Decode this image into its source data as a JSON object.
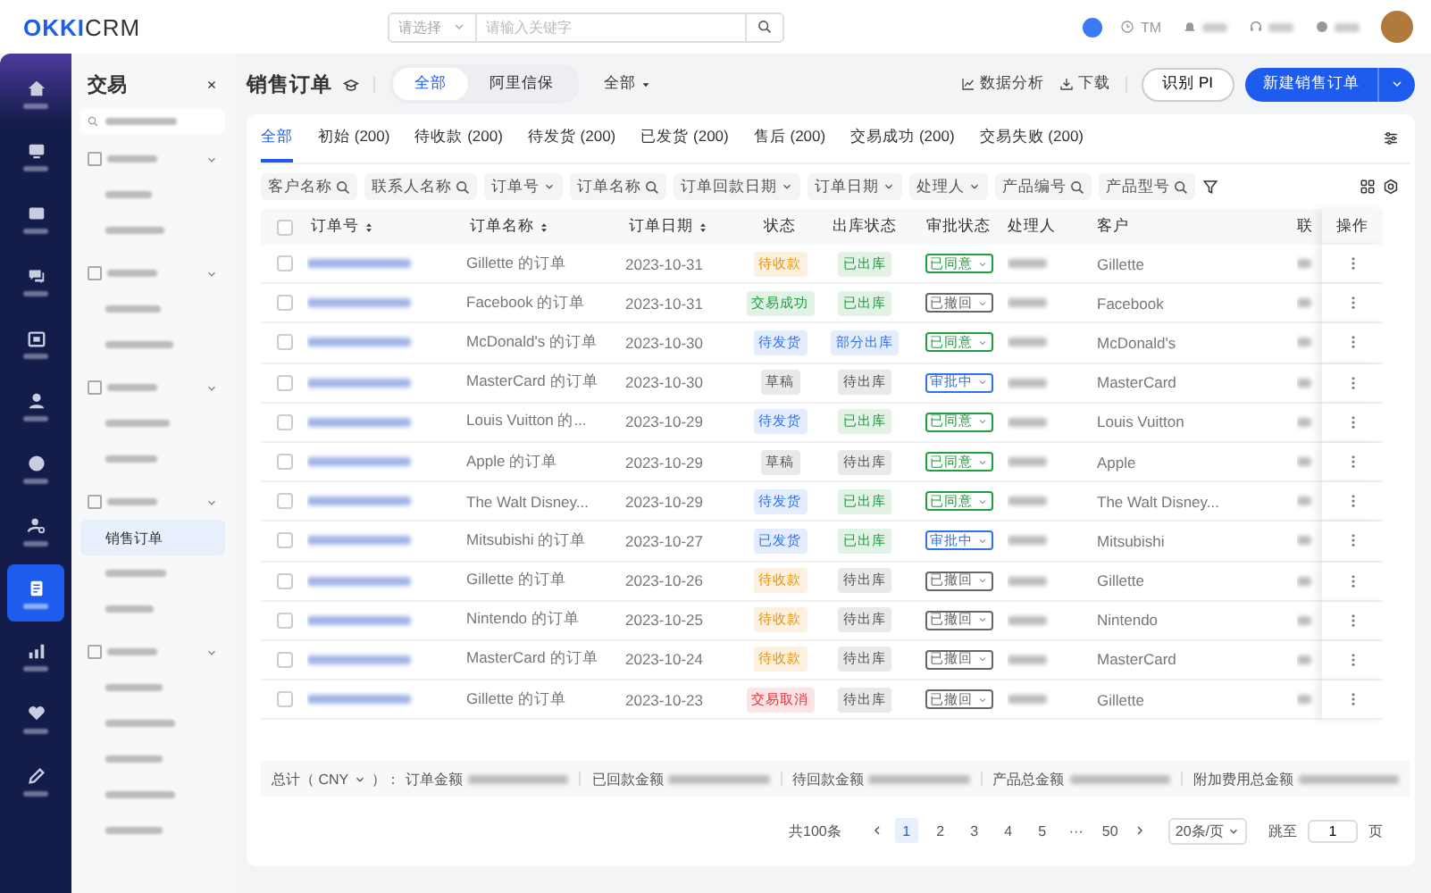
{
  "topbar": {
    "logo_bold": "OKKI",
    "logo_rest": "CRM",
    "search_select": "请选择",
    "search_placeholder": "请输入关键字",
    "user_short": "TM"
  },
  "rail": {
    "items": [
      {
        "selected": false
      },
      {
        "selected": false
      },
      {
        "selected": false
      },
      {
        "selected": false
      },
      {
        "selected": false
      },
      {
        "selected": false
      },
      {
        "selected": false
      },
      {
        "selected": false
      },
      {
        "selected": true
      },
      {
        "selected": false
      },
      {
        "selected": false
      },
      {
        "selected": false
      }
    ]
  },
  "menu": {
    "title": "交易",
    "groups": [
      {
        "expanded": true,
        "items": [
          {
            "selected": false
          },
          {
            "selected": false
          }
        ]
      },
      {
        "expanded": true,
        "items": [
          {
            "selected": false
          },
          {
            "selected": false
          }
        ]
      },
      {
        "expanded": true,
        "items": [
          {
            "selected": false
          },
          {
            "selected": false
          }
        ]
      },
      {
        "expanded": true,
        "items": [
          {
            "label": "销售订单",
            "selected": true
          },
          {
            "selected": false
          },
          {
            "selected": false
          }
        ]
      },
      {
        "expanded": true,
        "items": [
          {
            "selected": false
          },
          {
            "selected": false
          },
          {
            "selected": false
          },
          {
            "selected": false
          },
          {
            "selected": false
          }
        ]
      }
    ]
  },
  "header": {
    "title": "销售订单",
    "segments": [
      {
        "label": "全部",
        "selected": true
      },
      {
        "label": "阿里信保",
        "selected": false
      }
    ],
    "scope": "全部",
    "actions": [
      {
        "label": "数据分析",
        "kind": "chart"
      },
      {
        "label": "下载",
        "kind": "download"
      }
    ],
    "secondary_button": "识别 PI",
    "primary_button": "新建销售订单"
  },
  "tabs": [
    {
      "label": "全部",
      "selected": true
    },
    {
      "label": "初始 (200)",
      "selected": false
    },
    {
      "label": "待收款 (200)",
      "selected": false
    },
    {
      "label": "待发货 (200)",
      "selected": false
    },
    {
      "label": "已发货 (200)",
      "selected": false
    },
    {
      "label": "售后 (200)",
      "selected": false
    },
    {
      "label": "交易成功 (200)",
      "selected": false
    },
    {
      "label": "交易失败 (200)",
      "selected": false
    }
  ],
  "filters": [
    {
      "label": "客户名称",
      "kind": "search"
    },
    {
      "label": "联系人名称",
      "kind": "search"
    },
    {
      "label": "订单号",
      "kind": "select"
    },
    {
      "label": "订单名称",
      "kind": "search"
    },
    {
      "label": "订单回款日期",
      "kind": "select"
    },
    {
      "label": "订单日期",
      "kind": "select"
    },
    {
      "label": "处理人",
      "kind": "select"
    },
    {
      "label": "产品编号",
      "kind": "search"
    },
    {
      "label": "产品型号",
      "kind": "search"
    }
  ],
  "table": {
    "all_checked": false,
    "columns": [
      {
        "label": "订单号",
        "sortable": true
      },
      {
        "label": "订单名称",
        "sortable": true
      },
      {
        "label": "订单日期",
        "sortable": true
      },
      {
        "label": "状态",
        "sortable": false
      },
      {
        "label": "出库状态",
        "sortable": false
      },
      {
        "label": "审批状态",
        "sortable": false
      },
      {
        "label": "处理人",
        "sortable": false
      },
      {
        "label": "客户",
        "sortable": false
      },
      {
        "label": "联",
        "sortable": false
      },
      {
        "label": "操作",
        "sortable": false
      }
    ],
    "rows": [
      {
        "checked": false,
        "name": "Gillette 的订单",
        "date": "2023-10-31",
        "status": {
          "label": "待收款",
          "color": "#e8910c"
        },
        "outbound": {
          "label": "已出库",
          "color": "#1e9e3e"
        },
        "approval": {
          "label": "已同意",
          "color": "#1e9e3e"
        },
        "customer": "Gillette"
      },
      {
        "checked": false,
        "name": "Facebook 的订单",
        "date": "2023-10-31",
        "status": {
          "label": "交易成功",
          "color": "#1e9e3e"
        },
        "outbound": {
          "label": "已出库",
          "color": "#1e9e3e"
        },
        "approval": {
          "label": "已撤回",
          "color": "#666666"
        },
        "customer": "Facebook"
      },
      {
        "checked": false,
        "name": "McDonald's 的订单",
        "date": "2023-10-30",
        "status": {
          "label": "待发货",
          "color": "#2f72f0"
        },
        "outbound": {
          "label": "部分出库",
          "color": "#2f72f0"
        },
        "approval": {
          "label": "已同意",
          "color": "#1e9e3e"
        },
        "customer": "McDonald's"
      },
      {
        "checked": false,
        "name": "MasterCard 的订单",
        "date": "2023-10-30",
        "status": {
          "label": "草稿",
          "color": "#555555"
        },
        "outbound": {
          "label": "待出库",
          "color": "#555555"
        },
        "approval": {
          "label": "审批中",
          "color": "#2f72f0"
        },
        "customer": "MasterCard"
      },
      {
        "checked": false,
        "name": "Louis Vuitton 的...",
        "date": "2023-10-29",
        "status": {
          "label": "待发货",
          "color": "#2f72f0"
        },
        "outbound": {
          "label": "已出库",
          "color": "#1e9e3e"
        },
        "approval": {
          "label": "已同意",
          "color": "#1e9e3e"
        },
        "customer": "Louis Vuitton"
      },
      {
        "checked": false,
        "name": "Apple 的订单",
        "date": "2023-10-29",
        "status": {
          "label": "草稿",
          "color": "#555555"
        },
        "outbound": {
          "label": "待出库",
          "color": "#555555"
        },
        "approval": {
          "label": "已同意",
          "color": "#1e9e3e"
        },
        "customer": "Apple"
      },
      {
        "checked": false,
        "name": "The Walt Disney...",
        "date": "2023-10-29",
        "status": {
          "label": "待发货",
          "color": "#2f72f0"
        },
        "outbound": {
          "label": "已出库",
          "color": "#1e9e3e"
        },
        "approval": {
          "label": "已同意",
          "color": "#1e9e3e"
        },
        "customer": "The Walt Disney..."
      },
      {
        "checked": false,
        "name": "Mitsubishi 的订单",
        "date": "2023-10-27",
        "status": {
          "label": "已发货",
          "color": "#2f72f0"
        },
        "outbound": {
          "label": "已出库",
          "color": "#1e9e3e"
        },
        "approval": {
          "label": "审批中",
          "color": "#2f72f0"
        },
        "customer": "Mitsubishi"
      },
      {
        "checked": false,
        "name": "Gillette 的订单",
        "date": "2023-10-26",
        "status": {
          "label": "待收款",
          "color": "#e8910c"
        },
        "outbound": {
          "label": "待出库",
          "color": "#555555"
        },
        "approval": {
          "label": "已撤回",
          "color": "#666666"
        },
        "customer": "Gillette"
      },
      {
        "checked": false,
        "name": "Nintendo 的订单",
        "date": "2023-10-25",
        "status": {
          "label": "待收款",
          "color": "#e8910c"
        },
        "outbound": {
          "label": "待出库",
          "color": "#555555"
        },
        "approval": {
          "label": "已撤回",
          "color": "#666666"
        },
        "customer": "Nintendo"
      },
      {
        "checked": false,
        "name": "MasterCard 的订单",
        "date": "2023-10-24",
        "status": {
          "label": "待收款",
          "color": "#e8910c"
        },
        "outbound": {
          "label": "待出库",
          "color": "#555555"
        },
        "approval": {
          "label": "已撤回",
          "color": "#666666"
        },
        "customer": "MasterCard"
      },
      {
        "checked": false,
        "name": "Gillette 的订单",
        "date": "2023-10-23",
        "status": {
          "label": "交易取消",
          "color": "#e0303a"
        },
        "outbound": {
          "label": "待出库",
          "color": "#555555"
        },
        "approval": {
          "label": "已撤回",
          "color": "#666666"
        },
        "customer": "Gillette"
      }
    ]
  },
  "summary": {
    "label_open": "总计（ CNY",
    "label_close": "）：",
    "items": [
      "订单金额",
      "已回款金额",
      "待回款金额",
      "产品总金额",
      "附加费用总金额"
    ]
  },
  "pagination": {
    "total": "共100条",
    "pages": [
      {
        "label": "1",
        "selected": true
      },
      {
        "label": "2",
        "selected": false
      },
      {
        "label": "3",
        "selected": false
      },
      {
        "label": "4",
        "selected": false
      },
      {
        "label": "5",
        "selected": false
      },
      {
        "label": "···",
        "selected": false
      },
      {
        "label": "50",
        "selected": false
      }
    ],
    "page_size": "20条/页",
    "jump_label": "跳至",
    "jump_value": "1",
    "unit": "页"
  }
}
